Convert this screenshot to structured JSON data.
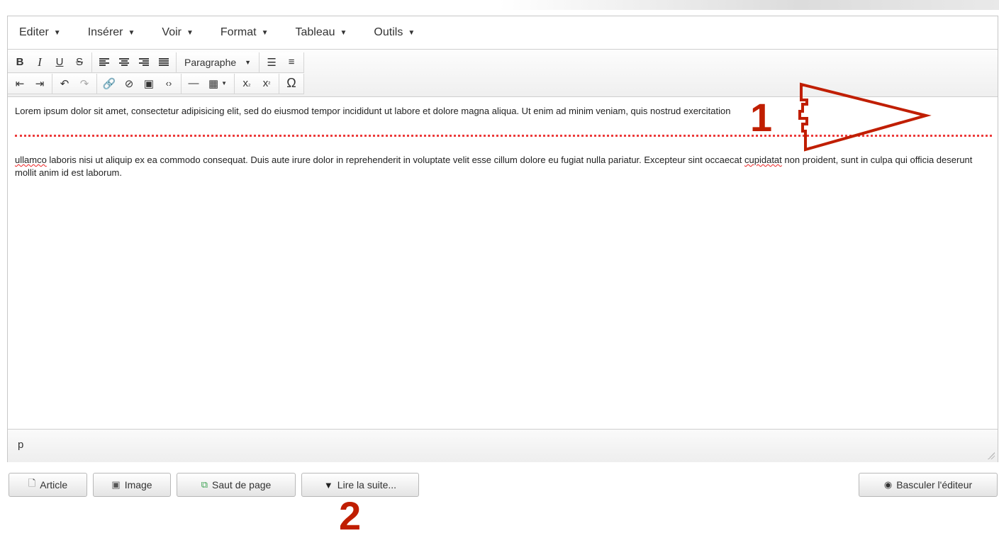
{
  "menubar": {
    "items": [
      {
        "label": "Editer"
      },
      {
        "label": "Insérer"
      },
      {
        "label": "Voir"
      },
      {
        "label": "Format"
      },
      {
        "label": "Tableau"
      },
      {
        "label": "Outils"
      }
    ]
  },
  "toolbar": {
    "format_select": "Paragraphe",
    "icons": [
      "bold-icon",
      "italic-icon",
      "underline-icon",
      "strikethrough-icon",
      "align-left-icon",
      "align-center-icon",
      "align-right-icon",
      "align-justify-icon",
      "bullet-list-icon",
      "numbered-list-icon",
      "outdent-icon",
      "indent-icon",
      "undo-icon",
      "redo-icon",
      "link-icon",
      "unlink-icon",
      "image-icon",
      "code-icon",
      "horizontal-rule-icon",
      "table-icon",
      "subscript-icon",
      "superscript-icon",
      "special-char-icon"
    ]
  },
  "content": {
    "para1": "Lorem ipsum dolor sit amet, consectetur adipisicing elit, sed do eiusmod tempor incididunt ut labore et dolore magna aliqua. Ut enim ad minim veniam, quis nostrud exercitation",
    "para2_word1": "ullamco",
    "para2_a": " laboris nisi ut aliquip ex ea commodo consequat. Duis aute irure dolor in reprehenderit in voluptate velit esse cillum dolore eu fugiat nulla pariatur. Excepteur sint occaecat ",
    "para2_word2": "cupidatat",
    "para2_b": " non proident, sunt in culpa qui officia deserunt mollit anim id est laborum."
  },
  "statusbar": {
    "path": "p"
  },
  "annotations": {
    "label1": "1",
    "label2": "2",
    "color": "#c01e00"
  },
  "buttons": {
    "article": "Article",
    "image": "Image",
    "pagebreak": "Saut de page",
    "readmore": "Lire la suite...",
    "toggle": "Basculer l'éditeur"
  }
}
